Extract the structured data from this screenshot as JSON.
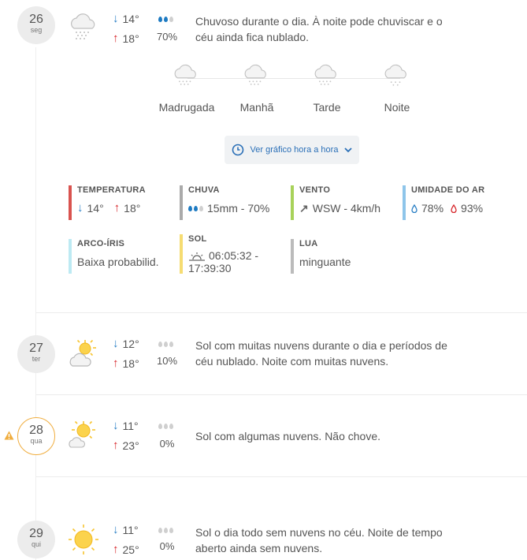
{
  "days": [
    {
      "day_num": "26",
      "weekday": "seg",
      "icon": "rain-cloud-icon",
      "min": "14°",
      "max": "18°",
      "rain_pct": "70%",
      "desc": "Chuvoso durante o dia. À noite pode chuviscar e o céu ainda fica nublado."
    },
    {
      "day_num": "27",
      "weekday": "ter",
      "icon": "sun-cloud-icon",
      "min": "12°",
      "max": "18°",
      "rain_pct": "10%",
      "desc": "Sol com muitas nuvens durante o dia e períodos de céu nublado. Noite com muitas nuvens."
    },
    {
      "day_num": "28",
      "weekday": "qua",
      "icon": "sun-small-cloud-icon",
      "min": "11°",
      "max": "23°",
      "rain_pct": "0%",
      "desc": "Sol com algumas nuvens. Não chove.",
      "alert": true
    },
    {
      "day_num": "29",
      "weekday": "qui",
      "icon": "sun-icon",
      "min": "11°",
      "max": "25°",
      "rain_pct": "0%",
      "desc": "Sol o dia todo sem nuvens no céu. Noite de tempo aberto ainda sem nuvens."
    }
  ],
  "periods": [
    "Madrugada",
    "Manhã",
    "Tarde",
    "Noite"
  ],
  "hourly_button": {
    "label": "Ver gráfico hora a hora",
    "icon": "clock-icon",
    "chevron": "chevron-down-icon"
  },
  "details": {
    "temperatura": {
      "label": "TEMPERATURA",
      "min": "14°",
      "max": "18°",
      "color": "#d9534f"
    },
    "chuva": {
      "label": "CHUVA",
      "value": "15mm - 70%",
      "color": "#aaaaaa"
    },
    "vento": {
      "label": "VENTO",
      "value": "WSW - 4km/h",
      "color": "#a8d25a"
    },
    "umidade": {
      "label": "UMIDADE DO AR",
      "min": "78%",
      "max": "93%",
      "color": "#8ec5ea"
    },
    "arco_iris": {
      "label": "ARCO-ÍRIS",
      "value": "Baixa probabilid.",
      "color": "#bdeaf3"
    },
    "sol": {
      "label": "SOL",
      "value": "06:05:32 - 17:39:30",
      "color": "#f6dc72"
    },
    "lua": {
      "label": "LUA",
      "value": "minguante",
      "color": "#bbbbbb"
    }
  },
  "colors": {
    "rain_blue": "#2a7fc5",
    "hot_red": "#d7262b",
    "alert_orange": "#f0ad3e",
    "sun_yellow": "#f7c531"
  }
}
